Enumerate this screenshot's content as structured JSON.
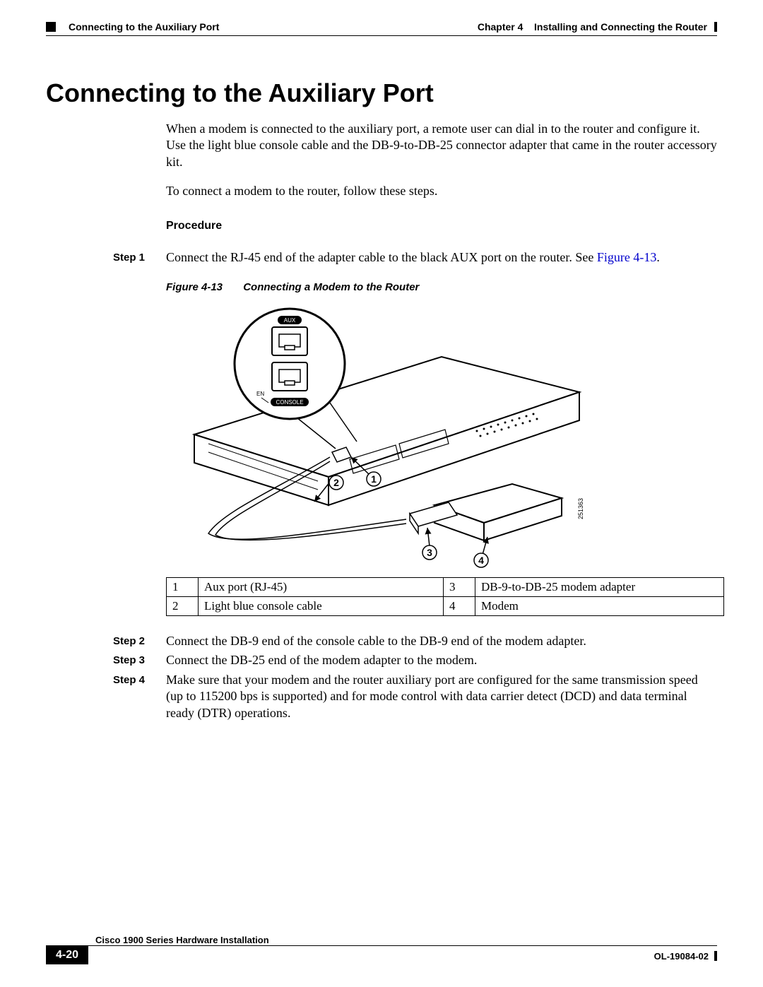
{
  "header": {
    "section": "Connecting to the Auxiliary Port",
    "chapter_label": "Chapter 4",
    "chapter_title": "Installing and Connecting the Router"
  },
  "title": "Connecting to the Auxiliary Port",
  "intro": {
    "p1": "When a modem is connected to the auxiliary port, a remote user can dial in to the router and configure it. Use the light blue console cable and the DB-9-to-DB-25 connector adapter that came in the router accessory kit.",
    "p2": "To connect a modem to the router, follow these steps."
  },
  "procedure_label": "Procedure",
  "steps": [
    {
      "label": "Step 1",
      "text_pre": "Connect the RJ-45 end of the adapter cable to the black AUX port on the router. See ",
      "figref": "Figure 4-13",
      "text_post": "."
    },
    {
      "label": "Step 2",
      "text": "Connect the DB-9 end of the console cable to the DB-9 end of the modem adapter."
    },
    {
      "label": "Step 3",
      "text": "Connect the DB-25 end of the modem adapter to the modem."
    },
    {
      "label": "Step 4",
      "text": "Make sure that your modem and the router auxiliary port are configured for the same transmission speed (up to 115200 bps is supported) and for mode control with data carrier detect (DCD) and data terminal ready (DTR) operations."
    }
  ],
  "figure": {
    "number": "Figure 4-13",
    "title": "Connecting a Modem to the Router",
    "labels": {
      "aux": "AUX",
      "console": "CONSOLE",
      "en": "EN"
    },
    "image_id": "251363",
    "callouts": [
      "1",
      "2",
      "3",
      "4"
    ]
  },
  "legend": [
    {
      "num": "1",
      "text": "Aux port (RJ-45)"
    },
    {
      "num": "2",
      "text": "Light blue console cable"
    },
    {
      "num": "3",
      "text": "DB-9-to-DB-25 modem adapter"
    },
    {
      "num": "4",
      "text": "Modem"
    }
  ],
  "footer": {
    "book": "Cisco 1900 Series Hardware Installation",
    "page": "4-20",
    "doc_id": "OL-19084-02"
  }
}
